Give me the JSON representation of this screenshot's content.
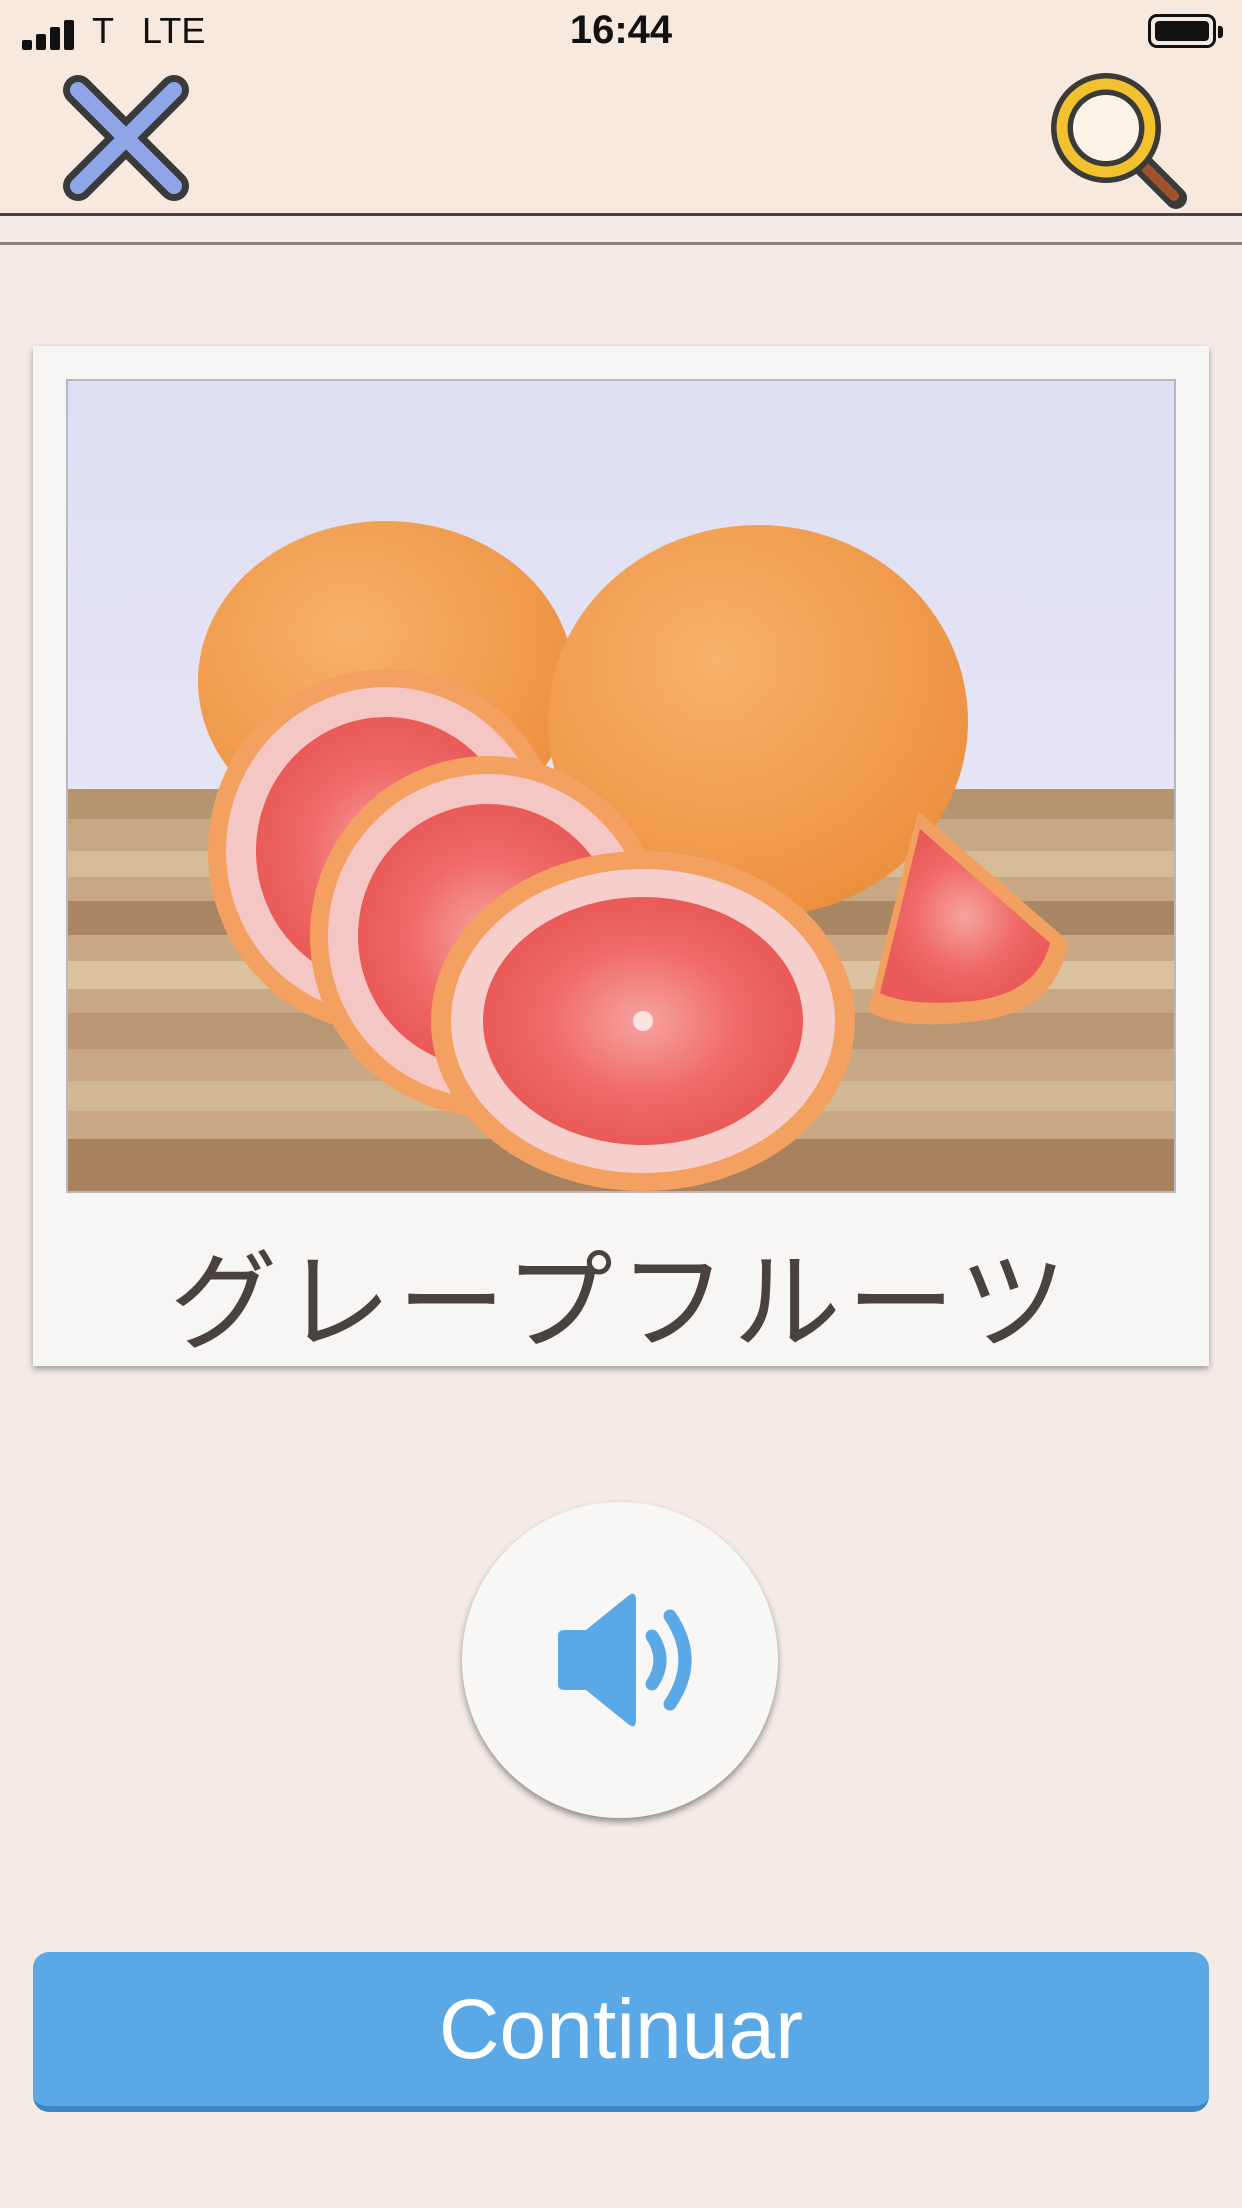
{
  "status_bar": {
    "carrier": "T",
    "network": "LTE",
    "time": "16:44"
  },
  "header": {
    "close_icon": "close-icon",
    "search_icon": "magnifier-icon"
  },
  "card": {
    "image_subject": "grapefruit-photo",
    "word": "グレープフルーツ"
  },
  "audio": {
    "icon": "speaker-icon"
  },
  "footer": {
    "continue_label": "Continuar"
  },
  "colors": {
    "primary_button": "#5aa9e6",
    "speaker_icon": "#5aa9e6",
    "close_icon": "#8ea6e8",
    "search_icon": "#f2c12e",
    "background": "#f4ebe6"
  }
}
